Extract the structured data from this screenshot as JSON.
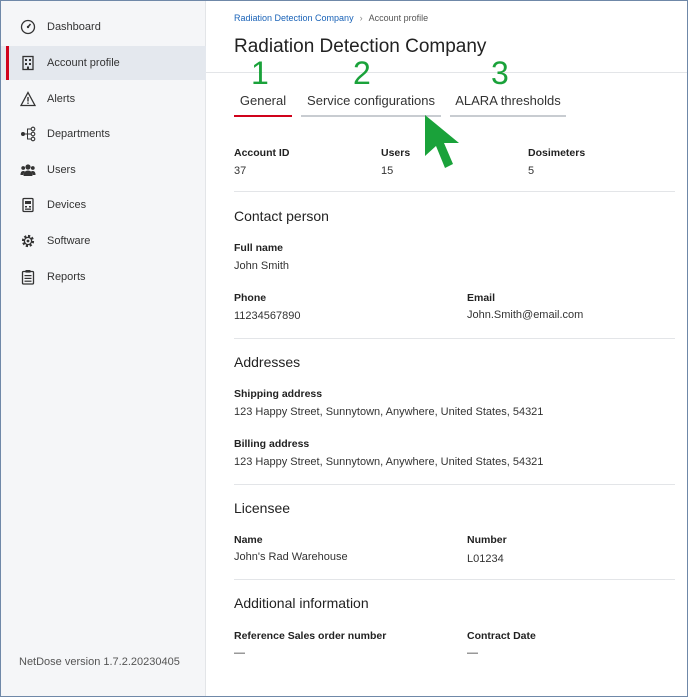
{
  "sidebar": {
    "items": [
      {
        "label": "Dashboard",
        "icon": "dashboard-gauge-icon"
      },
      {
        "label": "Account profile",
        "icon": "building-icon"
      },
      {
        "label": "Alerts",
        "icon": "warning-triangle-icon"
      },
      {
        "label": "Departments",
        "icon": "hierarchy-icon"
      },
      {
        "label": "Users",
        "icon": "users-icon"
      },
      {
        "label": "Devices",
        "icon": "device-icon"
      },
      {
        "label": "Software",
        "icon": "gear-icon"
      },
      {
        "label": "Reports",
        "icon": "clipboard-icon"
      }
    ],
    "active_index": 1,
    "version": "NetDose version 1.7.2.20230405"
  },
  "breadcrumb": {
    "link": "Radiation Detection Company",
    "separator": "›",
    "current": "Account profile"
  },
  "page_title": "Radiation Detection Company",
  "tabs": [
    {
      "label": "General",
      "number": "1"
    },
    {
      "label": "Service configurations",
      "number": "2"
    },
    {
      "label": "ALARA thresholds",
      "number": "3"
    }
  ],
  "summary": {
    "account_id_label": "Account ID",
    "account_id": "37",
    "users_label": "Users",
    "users": "15",
    "dosimeters_label": "Dosimeters",
    "dosimeters": "5"
  },
  "contact": {
    "title": "Contact person",
    "full_name_label": "Full name",
    "full_name": "John Smith",
    "phone_label": "Phone",
    "phone": "11234567890",
    "email_label": "Email",
    "email": "John.Smith@email.com"
  },
  "addresses": {
    "title": "Addresses",
    "shipping_label": "Shipping address",
    "shipping": "123 Happy Street, Sunnytown, Anywhere, United States, 54321",
    "billing_label": "Billing address",
    "billing": "123 Happy Street, Sunnytown, Anywhere, United States, 54321"
  },
  "licensee": {
    "title": "Licensee",
    "name_label": "Name",
    "name": "John's Rad Warehouse",
    "number_label": "Number",
    "number": "L01234"
  },
  "additional": {
    "title": "Additional information",
    "reference_label": "Reference Sales order number",
    "reference": "—",
    "contract_label": "Contract Date",
    "contract": "—"
  },
  "colors": {
    "accent": "#d0021b",
    "link": "#1a63b8",
    "annotation": "#1aa23a"
  }
}
